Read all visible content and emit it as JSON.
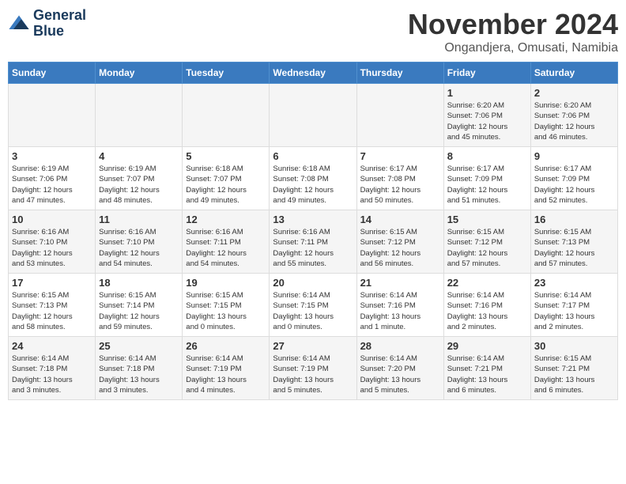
{
  "logo": {
    "line1": "General",
    "line2": "Blue"
  },
  "title": "November 2024",
  "subtitle": "Ongandjera, Omusati, Namibia",
  "weekdays": [
    "Sunday",
    "Monday",
    "Tuesday",
    "Wednesday",
    "Thursday",
    "Friday",
    "Saturday"
  ],
  "weeks": [
    [
      {
        "day": "",
        "info": ""
      },
      {
        "day": "",
        "info": ""
      },
      {
        "day": "",
        "info": ""
      },
      {
        "day": "",
        "info": ""
      },
      {
        "day": "",
        "info": ""
      },
      {
        "day": "1",
        "info": "Sunrise: 6:20 AM\nSunset: 7:06 PM\nDaylight: 12 hours\nand 45 minutes."
      },
      {
        "day": "2",
        "info": "Sunrise: 6:20 AM\nSunset: 7:06 PM\nDaylight: 12 hours\nand 46 minutes."
      }
    ],
    [
      {
        "day": "3",
        "info": "Sunrise: 6:19 AM\nSunset: 7:06 PM\nDaylight: 12 hours\nand 47 minutes."
      },
      {
        "day": "4",
        "info": "Sunrise: 6:19 AM\nSunset: 7:07 PM\nDaylight: 12 hours\nand 48 minutes."
      },
      {
        "day": "5",
        "info": "Sunrise: 6:18 AM\nSunset: 7:07 PM\nDaylight: 12 hours\nand 49 minutes."
      },
      {
        "day": "6",
        "info": "Sunrise: 6:18 AM\nSunset: 7:08 PM\nDaylight: 12 hours\nand 49 minutes."
      },
      {
        "day": "7",
        "info": "Sunrise: 6:17 AM\nSunset: 7:08 PM\nDaylight: 12 hours\nand 50 minutes."
      },
      {
        "day": "8",
        "info": "Sunrise: 6:17 AM\nSunset: 7:09 PM\nDaylight: 12 hours\nand 51 minutes."
      },
      {
        "day": "9",
        "info": "Sunrise: 6:17 AM\nSunset: 7:09 PM\nDaylight: 12 hours\nand 52 minutes."
      }
    ],
    [
      {
        "day": "10",
        "info": "Sunrise: 6:16 AM\nSunset: 7:10 PM\nDaylight: 12 hours\nand 53 minutes."
      },
      {
        "day": "11",
        "info": "Sunrise: 6:16 AM\nSunset: 7:10 PM\nDaylight: 12 hours\nand 54 minutes."
      },
      {
        "day": "12",
        "info": "Sunrise: 6:16 AM\nSunset: 7:11 PM\nDaylight: 12 hours\nand 54 minutes."
      },
      {
        "day": "13",
        "info": "Sunrise: 6:16 AM\nSunset: 7:11 PM\nDaylight: 12 hours\nand 55 minutes."
      },
      {
        "day": "14",
        "info": "Sunrise: 6:15 AM\nSunset: 7:12 PM\nDaylight: 12 hours\nand 56 minutes."
      },
      {
        "day": "15",
        "info": "Sunrise: 6:15 AM\nSunset: 7:12 PM\nDaylight: 12 hours\nand 57 minutes."
      },
      {
        "day": "16",
        "info": "Sunrise: 6:15 AM\nSunset: 7:13 PM\nDaylight: 12 hours\nand 57 minutes."
      }
    ],
    [
      {
        "day": "17",
        "info": "Sunrise: 6:15 AM\nSunset: 7:13 PM\nDaylight: 12 hours\nand 58 minutes."
      },
      {
        "day": "18",
        "info": "Sunrise: 6:15 AM\nSunset: 7:14 PM\nDaylight: 12 hours\nand 59 minutes."
      },
      {
        "day": "19",
        "info": "Sunrise: 6:15 AM\nSunset: 7:15 PM\nDaylight: 13 hours\nand 0 minutes."
      },
      {
        "day": "20",
        "info": "Sunrise: 6:14 AM\nSunset: 7:15 PM\nDaylight: 13 hours\nand 0 minutes."
      },
      {
        "day": "21",
        "info": "Sunrise: 6:14 AM\nSunset: 7:16 PM\nDaylight: 13 hours\nand 1 minute."
      },
      {
        "day": "22",
        "info": "Sunrise: 6:14 AM\nSunset: 7:16 PM\nDaylight: 13 hours\nand 2 minutes."
      },
      {
        "day": "23",
        "info": "Sunrise: 6:14 AM\nSunset: 7:17 PM\nDaylight: 13 hours\nand 2 minutes."
      }
    ],
    [
      {
        "day": "24",
        "info": "Sunrise: 6:14 AM\nSunset: 7:18 PM\nDaylight: 13 hours\nand 3 minutes."
      },
      {
        "day": "25",
        "info": "Sunrise: 6:14 AM\nSunset: 7:18 PM\nDaylight: 13 hours\nand 3 minutes."
      },
      {
        "day": "26",
        "info": "Sunrise: 6:14 AM\nSunset: 7:19 PM\nDaylight: 13 hours\nand 4 minutes."
      },
      {
        "day": "27",
        "info": "Sunrise: 6:14 AM\nSunset: 7:19 PM\nDaylight: 13 hours\nand 5 minutes."
      },
      {
        "day": "28",
        "info": "Sunrise: 6:14 AM\nSunset: 7:20 PM\nDaylight: 13 hours\nand 5 minutes."
      },
      {
        "day": "29",
        "info": "Sunrise: 6:14 AM\nSunset: 7:21 PM\nDaylight: 13 hours\nand 6 minutes."
      },
      {
        "day": "30",
        "info": "Sunrise: 6:15 AM\nSunset: 7:21 PM\nDaylight: 13 hours\nand 6 minutes."
      }
    ]
  ]
}
